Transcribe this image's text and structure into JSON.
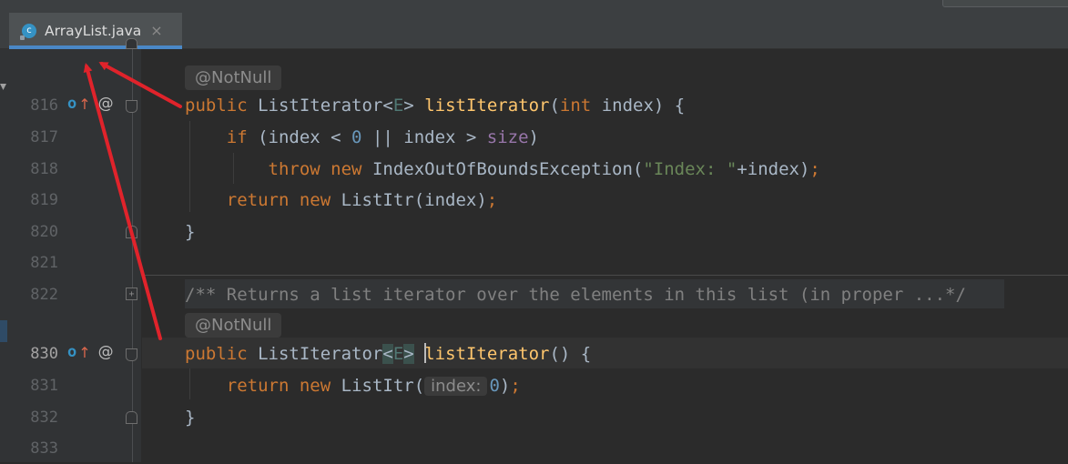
{
  "tab": {
    "title": "ArrayList.java",
    "icon_letter": "c",
    "close": "×"
  },
  "lines": [
    {
      "num": "816"
    },
    {
      "num": "817"
    },
    {
      "num": "818"
    },
    {
      "num": "819"
    },
    {
      "num": "820"
    },
    {
      "num": "821"
    },
    {
      "num": "822"
    },
    {
      "num": "830"
    },
    {
      "num": "831"
    },
    {
      "num": "832"
    },
    {
      "num": "833"
    }
  ],
  "annotations": {
    "not_null": "@NotNull"
  },
  "gutter_icons": {
    "implements": "o",
    "overrides": "↑",
    "at": "@"
  },
  "code": {
    "l816": {
      "kw1": "public",
      "type": "ListIterator",
      "lt": "<",
      "gen": "E",
      "gt": ">",
      "name": "listIterator",
      "open": "(",
      "kw2": "int",
      "rest": " index) {"
    },
    "l817": {
      "kw": "if",
      "a": " (index < ",
      "zero": "0",
      "b": " || index > ",
      "field": "size",
      "c": ")"
    },
    "l818": {
      "kw1": "throw",
      "kw2": "new",
      "a": " IndexOutOfBoundsException(",
      "str": "\"Index: \"",
      "b": "+index)",
      "semi": ";"
    },
    "l819": {
      "kw1": "return",
      "kw2": "new",
      "a": " ListItr(index)",
      "semi": ";"
    },
    "l820": {
      "text": "}"
    },
    "l822": {
      "comment": "/** Returns a list iterator over the elements in this list (in proper ...*/"
    },
    "l830": {
      "kw1": "public",
      "type": "ListIterator",
      "lt": "<",
      "gen": "E",
      "gt": ">",
      "name_first": "l",
      "name_rest": "istIterator",
      "rest": "() {"
    },
    "l831": {
      "kw1": "return",
      "kw2": "new",
      "a": " ListItr(",
      "hint": "index:",
      "zero": "0",
      "b": ")",
      "semi": ";"
    },
    "l832": {
      "text": "}"
    }
  },
  "colors": {
    "arrow": "#e0232b",
    "tab_accent": "#4a88c7"
  }
}
